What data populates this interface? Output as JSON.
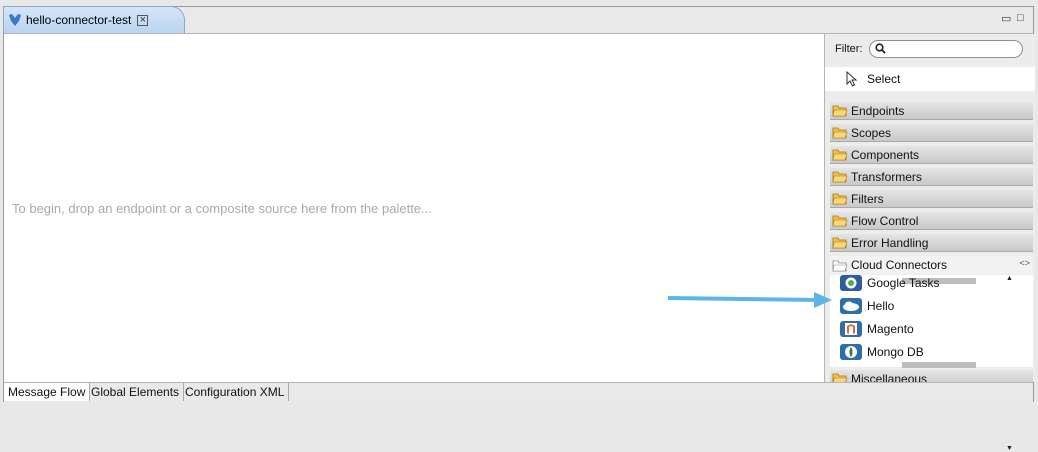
{
  "editor": {
    "tab_title": "hello-connector-test",
    "minimize_glyph": "▭",
    "maximize_glyph": "□"
  },
  "canvas": {
    "hint": "To begin, drop an endpoint or a composite source here from the palette..."
  },
  "palette": {
    "filter_label": "Filter:",
    "filter_value": "",
    "select_label": "Select",
    "drawers": [
      {
        "label": "Endpoints"
      },
      {
        "label": "Scopes"
      },
      {
        "label": "Components"
      },
      {
        "label": "Transformers"
      },
      {
        "label": "Filters"
      },
      {
        "label": "Flow Control"
      },
      {
        "label": "Error Handling"
      },
      {
        "label": "Cloud Connectors"
      },
      {
        "label": "Miscellaneous"
      }
    ],
    "cloud_connectors": [
      {
        "label": "Google Tasks",
        "icon": "google-tasks-icon",
        "color": "#3a6fb0"
      },
      {
        "label": "Hello",
        "icon": "cloud-icon",
        "color": "#2f6ea8"
      },
      {
        "label": "Magento",
        "icon": "magento-icon",
        "color": "#e06a2a"
      },
      {
        "label": "Mongo DB",
        "icon": "mongodb-icon",
        "color": "#2d7a3e"
      }
    ],
    "drawer_expand_glyph": "<>"
  },
  "bottom_tabs": [
    {
      "label": "Message Flow"
    },
    {
      "label": "Global Elements"
    },
    {
      "label": "Configuration XML"
    }
  ],
  "colors": {
    "annotation_arrow": "#5db4e6",
    "tab_active": "#c9ddf4"
  }
}
